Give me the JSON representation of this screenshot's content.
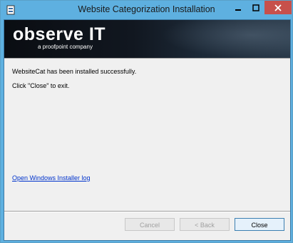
{
  "window": {
    "title": "Website Categorization Installation",
    "controls": {
      "minimize": "minimize",
      "maximize": "maximize",
      "close": "close"
    }
  },
  "banner": {
    "logo_text": "observe IT",
    "logo_subtext": "a proofpoint company"
  },
  "content": {
    "success_message": "WebsiteCat has been installed successfully.",
    "instruction": "Click \"Close\" to exit.",
    "log_link": "Open Windows Installer log"
  },
  "buttons": {
    "cancel": "Cancel",
    "back": "< Back",
    "close": "Close"
  },
  "colors": {
    "titlebar": "#5eb0e0",
    "close_control": "#c7504b",
    "link": "#0033cc",
    "dialog_background": "#f0f0f0"
  }
}
